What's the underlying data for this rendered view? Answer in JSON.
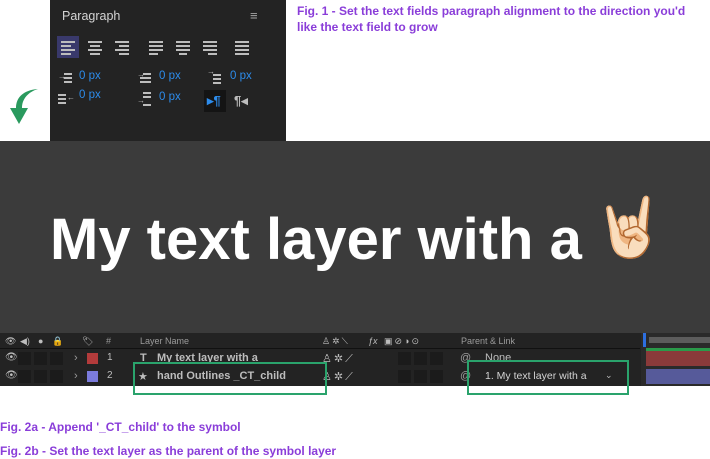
{
  "paragraph_panel": {
    "title": "Paragraph",
    "menu_icon": "hamburger-icon",
    "spacing": {
      "indent_left": "0 px",
      "indent_first": "0 px",
      "indent_right": "0 px",
      "space_before": "0 px",
      "space_after": "0 px"
    }
  },
  "captions": {
    "fig1": "Fig. 1 - Set the text fields paragraph alignment to the direction you'd like the text field to grow",
    "fig2a": "Fig. 2a - Append '_CT_child' to the symbol",
    "fig2b": "Fig. 2b - Set the text layer as the parent of the symbol layer"
  },
  "canvas": {
    "text": "My text layer with a",
    "emoji": "🤘🏻"
  },
  "timeline": {
    "headers": {
      "number": "#",
      "layer_name": "Layer Name",
      "parent": "Parent & Link"
    },
    "layers": [
      {
        "number": "1",
        "type_icon": "T",
        "name": "My text layer with a",
        "parent": "None",
        "label_color": "#b33b3b"
      },
      {
        "number": "2",
        "type_icon": "★",
        "name": "hand Outlines _CT_child",
        "parent": "1. My text layer with a",
        "label_color": "#7b7bdc"
      }
    ]
  },
  "colors": {
    "accent_purple": "#8a3dd9",
    "highlight_green": "#2aa36c",
    "value_blue": "#2d8ceb"
  }
}
